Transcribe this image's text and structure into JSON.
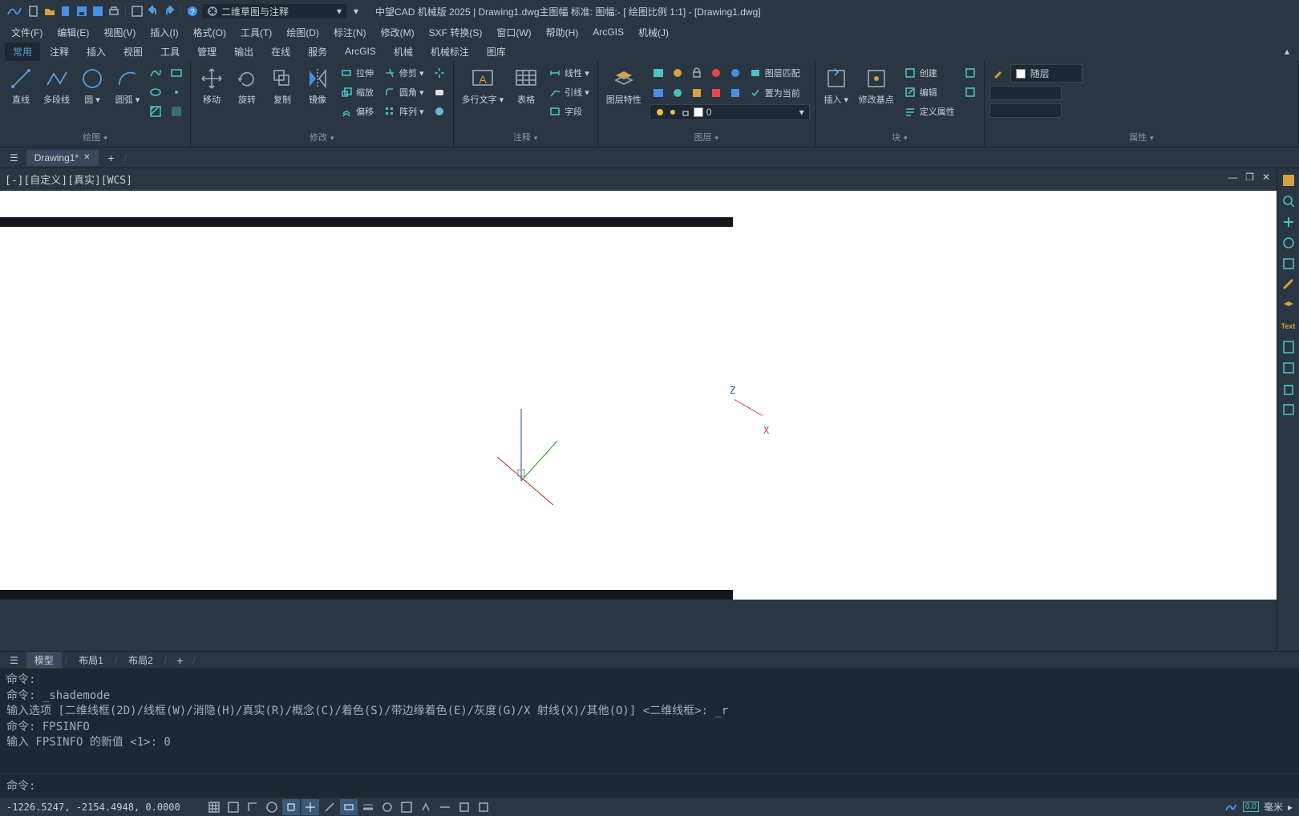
{
  "title": "中望CAD 机械版 2025 | Drawing1.dwg主图幅  标准: 图幅:- [ 绘图比例 1:1] - [Drawing1.dwg]",
  "workspace": "二维草图与注释",
  "menubar": [
    "文件(F)",
    "编辑(E)",
    "视图(V)",
    "插入(I)",
    "格式(O)",
    "工具(T)",
    "绘图(D)",
    "标注(N)",
    "修改(M)",
    "SXF 转换(S)",
    "窗口(W)",
    "帮助(H)",
    "ArcGIS",
    "机械(J)"
  ],
  "ribbon_tabs": [
    "常用",
    "注释",
    "插入",
    "视图",
    "工具",
    "管理",
    "输出",
    "在线",
    "服务",
    "ArcGIS",
    "机械",
    "机械标注",
    "图库"
  ],
  "ribbon_active": 0,
  "panels": {
    "draw": {
      "title": "绘图",
      "items": [
        "直线",
        "多段线",
        "圆",
        "圆弧"
      ]
    },
    "modify": {
      "title": "修改",
      "items": [
        "移动",
        "旋转",
        "复制",
        "镜像"
      ],
      "rows": [
        "拉伸",
        "缩放",
        "偏移",
        "修剪",
        "圆角",
        "阵列"
      ]
    },
    "annot": {
      "title": "注释",
      "items": [
        "多行文字",
        "表格"
      ],
      "rows": [
        "线性",
        "引线",
        "字段"
      ]
    },
    "layer": {
      "title": "图层",
      "btn": "图层特性",
      "match": "图层匹配",
      "current": "置为当前",
      "value": "0"
    },
    "block": {
      "title": "块",
      "items": [
        "插入",
        "修改基点"
      ],
      "rows": [
        "创建",
        "编辑",
        "定义属性"
      ]
    },
    "prop": {
      "title": "属性",
      "color": "随层"
    }
  },
  "doc_tab": "Drawing1*",
  "view_ctrl": "[-][自定义][真实][WCS]",
  "axis": {
    "z": "Z",
    "x": "X"
  },
  "layout_tabs": [
    "模型",
    "布局1",
    "布局2"
  ],
  "layout_active": 0,
  "cmd_history": "命令:\n命令: _shademode\n输入选项 [二维线框(2D)/线框(W)/消隐(H)/真实(R)/概念(C)/着色(S)/带边缘着色(E)/灰度(G)/X 射线(X)/其他(O)] <二维线框>: _r\n命令: FPSINFO\n输入 FPSINFO 的新值 <1>: 0",
  "cmd_prompt": "命令:",
  "status": {
    "coords": "-1226.5247, -2154.4948, 0.0000",
    "units": "毫米"
  }
}
